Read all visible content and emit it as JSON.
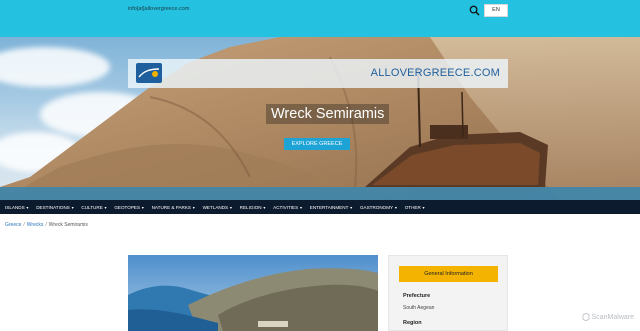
{
  "header": {
    "email": "info[at]allovergreece.com",
    "lang": "EN",
    "site_name": "ALLOVERGREECE.COM"
  },
  "hero": {
    "title": "Wreck Semiramis",
    "cta": "EXPLORE GREECE"
  },
  "nav": {
    "items": [
      "ISLANDS",
      "DESTINATIONS",
      "CULTURE",
      "GEOTOPES",
      "NATURE & PARKS",
      "WETLANDS",
      "RELIGION",
      "ACTIVITIES",
      "ENTERTAINMENT",
      "GASTRONOMY",
      "OTHER"
    ]
  },
  "breadcrumb": {
    "home": "Greece",
    "section": "Wrecks",
    "current": "Wreck Semiramis"
  },
  "info": {
    "button": "General Information",
    "prefecture_label": "Prefecture",
    "prefecture_value": "South Aegean",
    "region_label": "Region"
  },
  "watermark": "ScanMalware",
  "colors": {
    "topbar": "#24c2e0",
    "nav": "#0c1b2e",
    "accent": "#f3b300",
    "cta": "#1ea3d6"
  }
}
